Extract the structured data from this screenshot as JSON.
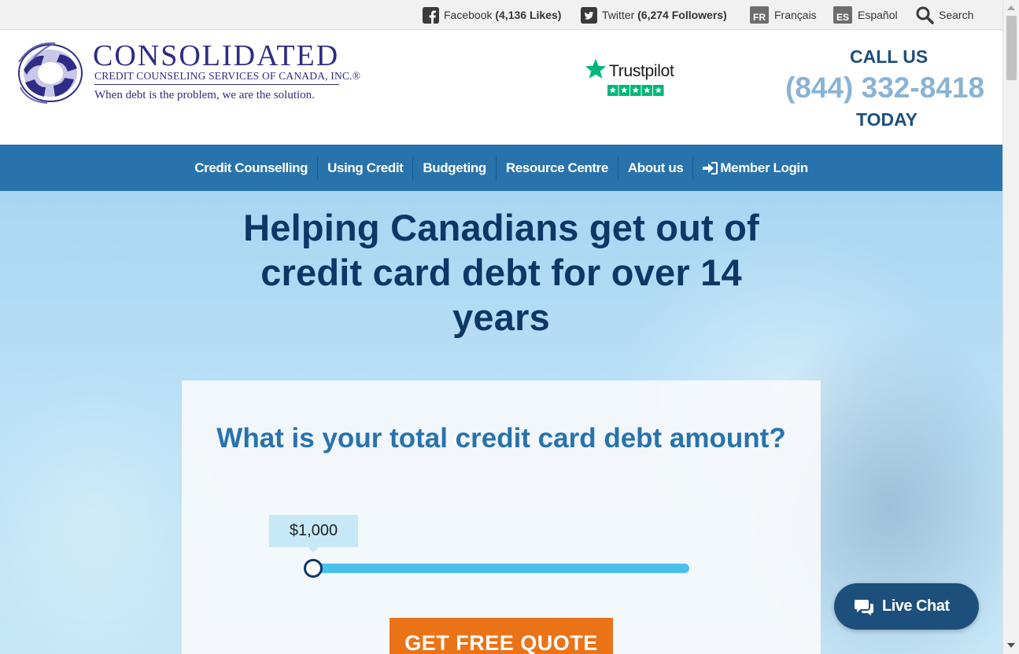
{
  "topbar": {
    "facebook": {
      "label": "Facebook",
      "count": "(4,136 Likes)",
      "icon": "facebook-icon"
    },
    "twitter": {
      "label": "Twitter",
      "count": "(6,274 Followers)",
      "icon": "twitter-icon"
    },
    "french": {
      "badge": "FR",
      "label": "Français"
    },
    "spanish": {
      "badge": "ES",
      "label": "Español"
    },
    "search": {
      "label": "Search",
      "icon": "search-icon"
    }
  },
  "header": {
    "logo": {
      "name": "CONSOLIDATED",
      "subtitle": "CREDIT COUNSELING SERVICES OF CANADA, INC.®",
      "tagline": "When debt is the problem, we are the solution."
    },
    "trustpilot": {
      "label": "Trustpilot",
      "stars": 5
    },
    "call_us": "CALL US",
    "phone": "(844) 332-8418",
    "today": "TODAY"
  },
  "nav": {
    "items": [
      {
        "label": "Credit Counselling"
      },
      {
        "label": "Using Credit"
      },
      {
        "label": "Budgeting"
      },
      {
        "label": "Resource Centre"
      },
      {
        "label": "About us"
      },
      {
        "label": "Member Login",
        "icon": "sign-in-icon"
      }
    ]
  },
  "hero": {
    "title": "Helping Canadians get out of credit card debt for over 14 years",
    "question": "What is your total credit card debt amount?",
    "slider_value": "$1,000",
    "slider_fraction": 0,
    "cta": "GET FREE QUOTE"
  },
  "livechat": {
    "label": "Live Chat",
    "icon": "chat-icon"
  },
  "colors": {
    "nav": "#2873ac",
    "dark_blue": "#0d3766",
    "phone": "#8ab3d5",
    "cta": "#ea7318",
    "slider": "#49c1ec",
    "trustpilot_green": "#00b67a",
    "logo": "#2e2c84"
  }
}
